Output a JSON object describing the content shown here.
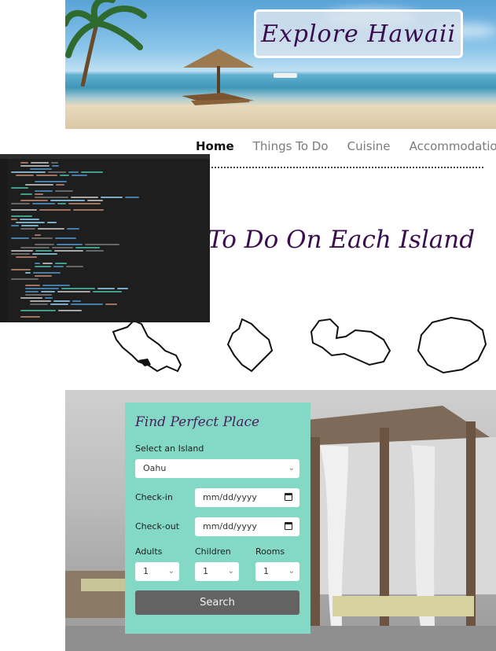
{
  "hero": {
    "title": "Explore Hawaii"
  },
  "nav": {
    "items": [
      "Home",
      "Things To Do",
      "Cuisine",
      "Accommodation"
    ],
    "active": "Home"
  },
  "section": {
    "title": "To Do On Each Island"
  },
  "islands": [
    {
      "name": "Oahu"
    },
    {
      "name": "Hawaii"
    },
    {
      "name": "Maui"
    },
    {
      "name": "Kauai"
    }
  ],
  "booking": {
    "title": "Find Perfect Place",
    "island_label": "Select an Island",
    "island_value": "Oahu",
    "checkin_label": "Check-in",
    "checkin_placeholder": "mm/dd/yyyy",
    "checkout_label": "Check-out",
    "checkout_placeholder": "mm/dd/yyyy",
    "adults_label": "Adults",
    "adults_value": "1",
    "children_label": "Children",
    "children_value": "1",
    "rooms_label": "Rooms",
    "rooms_value": "1",
    "search_label": "Search"
  },
  "colors": {
    "form_bg": "#84d8c6",
    "title_purple": "#3a0d4f",
    "button": "#636363"
  }
}
